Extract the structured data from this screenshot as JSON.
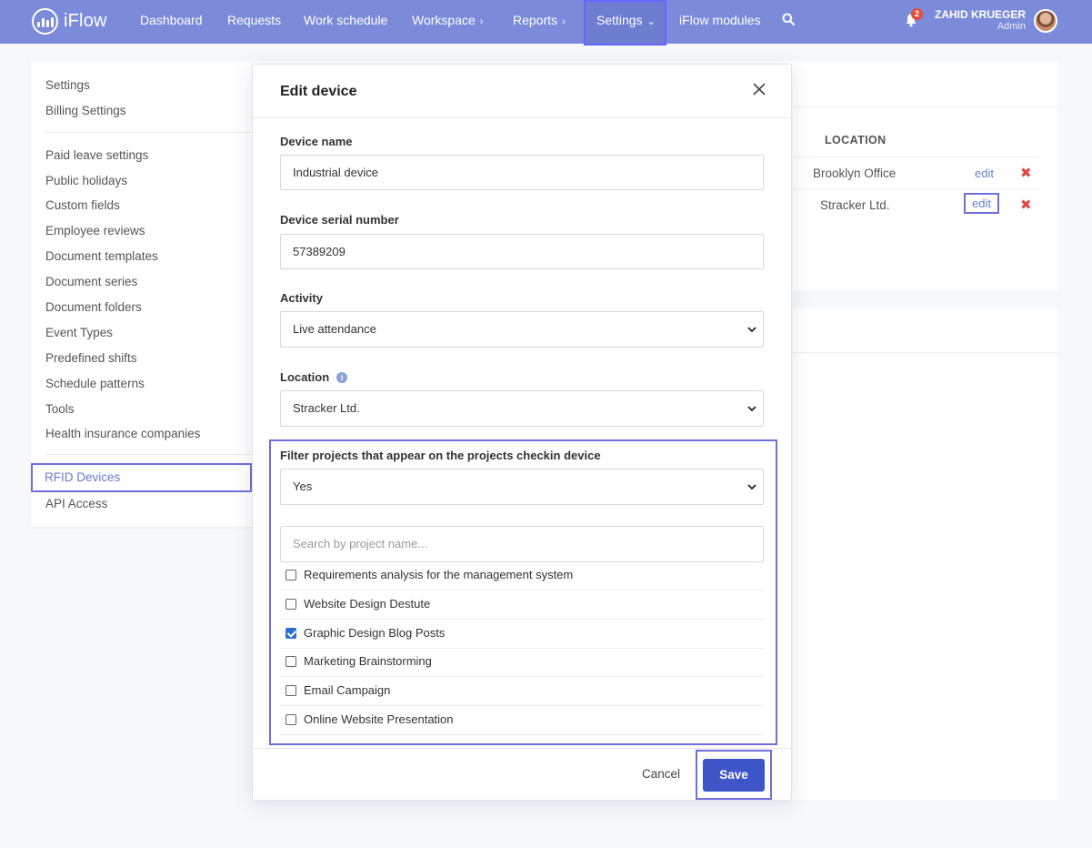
{
  "app": {
    "logo_text": "iFlow"
  },
  "nav": {
    "items": [
      {
        "label": "Dashboard"
      },
      {
        "label": "Requests"
      },
      {
        "label": "Work schedule"
      },
      {
        "label": "Workspace"
      },
      {
        "label": "Reports"
      },
      {
        "label": "Settings"
      },
      {
        "label": "iFlow modules"
      }
    ],
    "notifications_count": "2",
    "user_name": "ZAHID KRUEGER",
    "user_role": "Admin"
  },
  "sidebar": {
    "group1": [
      "Settings",
      "Billing Settings"
    ],
    "group2": [
      "Paid leave settings",
      "Public holidays",
      "Custom fields",
      "Employee reviews",
      "Document templates",
      "Document series",
      "Document folders",
      "Event Types",
      "Predefined shifts",
      "Schedule patterns",
      "Tools",
      "Health insurance companies"
    ],
    "group3": [
      "RFID Devices",
      "API Access"
    ]
  },
  "devices_table": {
    "location_header": "LOCATION",
    "rows": [
      {
        "location": "Brooklyn Office",
        "edit": "edit"
      },
      {
        "location": "Stracker Ltd.",
        "edit": "edit"
      }
    ]
  },
  "modal": {
    "title": "Edit device",
    "device_name_label": "Device name",
    "device_name_value": "Industrial device",
    "serial_label": "Device serial number",
    "serial_value": "57389209",
    "activity_label": "Activity",
    "activity_value": "Live attendance",
    "location_label": "Location",
    "location_value": "Stracker Ltd.",
    "filter_label": "Filter projects that appear on the projects checkin device",
    "filter_value": "Yes",
    "search_placeholder": "Search by project name...",
    "projects": [
      {
        "name": "Requirements analysis for the management system",
        "checked": false
      },
      {
        "name": "Website Design Destute",
        "checked": false
      },
      {
        "name": "Graphic Design Blog Posts",
        "checked": true
      },
      {
        "name": "Marketing Brainstorming",
        "checked": false
      },
      {
        "name": "Email Campaign",
        "checked": false
      },
      {
        "name": "Online Website Presentation",
        "checked": false
      }
    ],
    "cancel_label": "Cancel",
    "save_label": "Save"
  },
  "colors": {
    "nav_bg": "#7b8bd9",
    "accent": "#3d55c6",
    "highlight_outline": "#6f6fdc",
    "delete": "#e04848"
  }
}
